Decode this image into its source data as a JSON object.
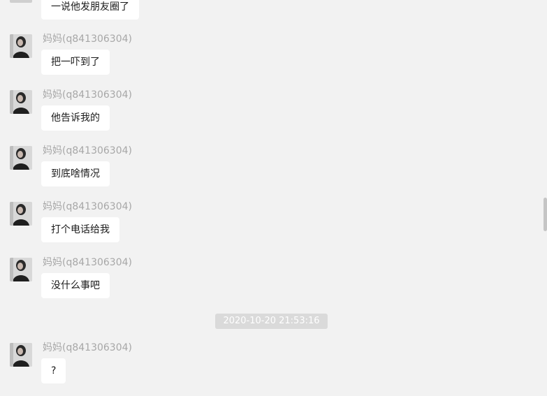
{
  "conversation": {
    "first_message": "一说他发朋友圈了",
    "messages": [
      {
        "sender": "妈妈(q841306304)",
        "text": "把一吓到了"
      },
      {
        "sender": "妈妈(q841306304)",
        "text": "他告诉我的"
      },
      {
        "sender": "妈妈(q841306304)",
        "text": "到底啥情况"
      },
      {
        "sender": "妈妈(q841306304)",
        "text": "打个电话给我"
      },
      {
        "sender": "妈妈(q841306304)",
        "text": "没什么事吧"
      },
      {
        "sender": "妈妈(q841306304)",
        "text": "?"
      }
    ],
    "timestamp": "2020-10-20 21:53:16"
  },
  "colors": {
    "background": "#f2f2f2",
    "bubble": "#ffffff",
    "sender_text": "#a7a7a7",
    "timestamp_bg": "#dadada"
  },
  "icons": {
    "avatar": "user-avatar-photo"
  }
}
